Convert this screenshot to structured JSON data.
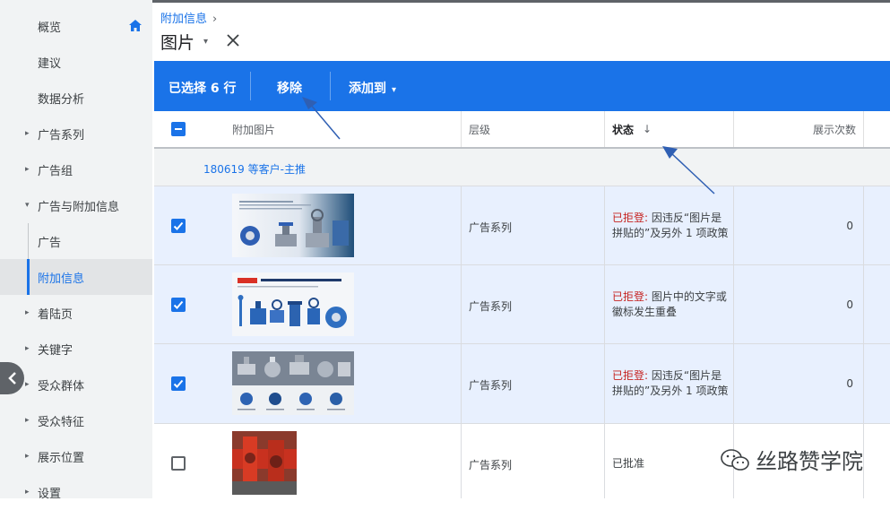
{
  "sidebar": {
    "items": [
      {
        "label": "概览",
        "caret": ""
      },
      {
        "label": "建议",
        "caret": ""
      },
      {
        "label": "数据分析",
        "caret": ""
      },
      {
        "label": "广告系列",
        "caret": "▸"
      },
      {
        "label": "广告组",
        "caret": "▸"
      },
      {
        "label": "广告与附加信息",
        "caret": "▾"
      },
      {
        "label": "广告",
        "caret": ""
      },
      {
        "label": "附加信息",
        "caret": ""
      },
      {
        "label": "着陆页",
        "caret": "▸"
      },
      {
        "label": "关键字",
        "caret": "▸"
      },
      {
        "label": "受众群体",
        "caret": "▸"
      },
      {
        "label": "受众特征",
        "caret": "▸"
      },
      {
        "label": "展示位置",
        "caret": "▸"
      },
      {
        "label": "设置",
        "caret": "▸"
      }
    ]
  },
  "header": {
    "breadcrumb": "附加信息",
    "breadcrumb_chevron": "›",
    "title": "图片",
    "title_dropdown": "▾"
  },
  "selection_bar": {
    "count": "已选择 6 行",
    "remove": "移除",
    "add_to": "添加到",
    "add_to_caret": "▾"
  },
  "table": {
    "headers": {
      "image": "附加图片",
      "level": "层级",
      "status": "状态",
      "sort_arrow": "↓",
      "impressions": "展示次数"
    },
    "group": "180619 等客户-主推",
    "rows": [
      {
        "level": "广告系列",
        "status_prefix": "已拒登:",
        "status_text": " 因违反“图片是拼贴的”及另外 1 项政策",
        "impressions": "0",
        "selected": true
      },
      {
        "level": "广告系列",
        "status_prefix": "已拒登:",
        "status_text": " 图片中的文字或徽标发生重叠",
        "impressions": "0",
        "selected": true
      },
      {
        "level": "广告系列",
        "status_prefix": "已拒登:",
        "status_text": " 因违反“图片是拼贴的”及另外 1 项政策",
        "impressions": "0",
        "selected": true
      },
      {
        "level": "广告系列",
        "status_prefix": "",
        "status_text": "已批准",
        "impressions": "",
        "selected": false
      }
    ]
  },
  "watermark": "丝路赞学院",
  "colors": {
    "accent": "#1a73e8",
    "rejected": "#c5221f",
    "sidebar": "#f1f3f4"
  }
}
